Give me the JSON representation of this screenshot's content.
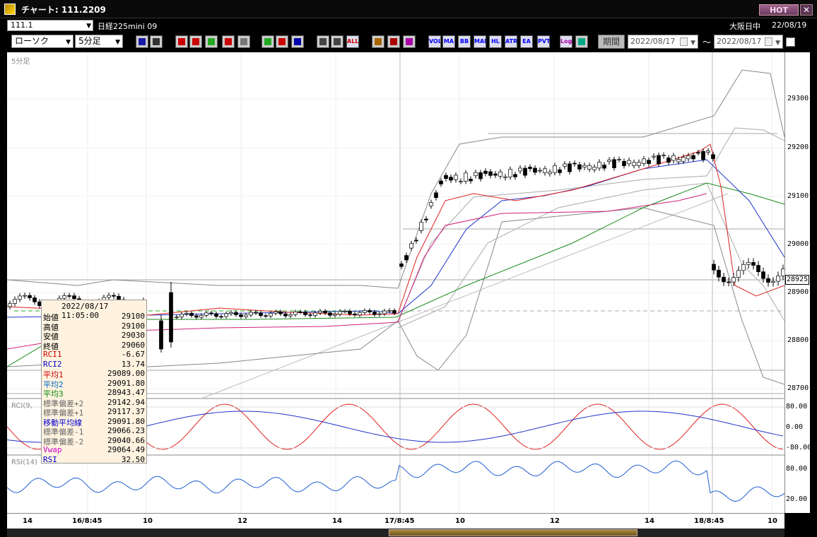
{
  "window": {
    "title": "チャート: 111.2209",
    "hot_label": "HOT",
    "close_label": "✕"
  },
  "header": {
    "symbol_code": "111.1",
    "instrument_name": "日経225mini 09",
    "market_name": "大阪日中",
    "date": "22/08/19"
  },
  "toolbar": {
    "chart_type": "ローソク",
    "interval": "5分足",
    "buttons": [
      {
        "name": "zoom-icon",
        "label": "",
        "color": "#1a1aaa"
      },
      {
        "name": "bar-icon",
        "label": "",
        "color": "#333"
      },
      {
        "name": "down-arrow-icon",
        "label": "",
        "color": "#c00"
      },
      {
        "name": "magnifier-icon",
        "label": "",
        "color": "#c00"
      },
      {
        "name": "bars-color-icon",
        "label": "",
        "color": "#2a2"
      },
      {
        "name": "plus-line-icon",
        "label": "",
        "color": "#c00"
      },
      {
        "name": "disabled-icon",
        "label": "",
        "color": "#777"
      },
      {
        "name": "pen-icon",
        "label": "",
        "color": "#2a2"
      },
      {
        "name": "cursor-icon",
        "label": "",
        "color": "#c00"
      },
      {
        "name": "undo-icon",
        "label": "",
        "color": "#00a"
      },
      {
        "name": "candle-icon",
        "label": "",
        "color": "#444"
      },
      {
        "name": "candle-delete-icon",
        "label": "",
        "color": "#444"
      },
      {
        "name": "all-icon",
        "label": "ALL",
        "color": "#c00"
      },
      {
        "name": "tool-icon",
        "label": "",
        "color": "#a60"
      },
      {
        "name": "wrench-icon",
        "label": "",
        "color": "#a00"
      },
      {
        "name": "palette-icon",
        "label": "",
        "color": "#a0a"
      },
      {
        "name": "vol-icon",
        "label": "VOL",
        "color": "#00f"
      },
      {
        "name": "ma-icon",
        "label": "MA",
        "color": "#00f"
      },
      {
        "name": "bb-icon",
        "label": "BB",
        "color": "#00f"
      },
      {
        "name": "mae-icon",
        "label": "MAE",
        "color": "#00f"
      },
      {
        "name": "hl-icon",
        "label": "HL",
        "color": "#00f"
      },
      {
        "name": "atr-icon",
        "label": "ATR",
        "color": "#00f"
      },
      {
        "name": "ea-icon",
        "label": "EA",
        "color": "#00f"
      },
      {
        "name": "pvt-icon",
        "label": "PVT",
        "color": "#00f"
      },
      {
        "name": "log-icon",
        "label": "Log",
        "color": "#a0a"
      },
      {
        "name": "export-icon",
        "label": "",
        "color": "#0a8"
      }
    ],
    "period_label": "期間",
    "date_from": "2022/08/17",
    "date_to": "2022/08/17",
    "tilde": "〜"
  },
  "chart": {
    "interval_label": "5分足",
    "price_labels": [
      "29300",
      "29200",
      "29100",
      "29000",
      "28900",
      "28800",
      "28700"
    ],
    "current_price": "28925",
    "rci_label": "RCI(9,",
    "rci_levels": [
      "80.00",
      "0.00",
      "-80.00"
    ],
    "rsi_label": "RSI(14)",
    "rsi_levels": [
      "80.00",
      "20.00"
    ],
    "time_labels": [
      "14",
      "16/8:45",
      "10",
      "12",
      "14",
      "17/8:45",
      "10",
      "12",
      "14",
      "18/8:45",
      "10"
    ]
  },
  "info_panel": {
    "datetime": "2022/08/17 11:05:00",
    "rows": [
      {
        "k": "始値",
        "v": "29100",
        "c": "#000"
      },
      {
        "k": "高値",
        "v": "29100",
        "c": "#000"
      },
      {
        "k": "安値",
        "v": "29030",
        "c": "#000"
      },
      {
        "k": "終値",
        "v": "29060",
        "c": "#000"
      },
      {
        "k": "RCI1",
        "v": "-6.67",
        "c": "#c00"
      },
      {
        "k": "RCI2",
        "v": "13.74",
        "c": "#00c"
      },
      {
        "k": "平均1",
        "v": "29089.00",
        "c": "#c00"
      },
      {
        "k": "平均2",
        "v": "29091.80",
        "c": "#06c"
      },
      {
        "k": "平均3",
        "v": "28943.47",
        "c": "#080"
      },
      {
        "k": "標準偏差+2",
        "v": "29142.94",
        "c": "#666"
      },
      {
        "k": "標準偏差+1",
        "v": "29117.37",
        "c": "#666"
      },
      {
        "k": "移動平均線",
        "v": "29091.80",
        "c": "#00c"
      },
      {
        "k": "標準偏差-1",
        "v": "29066.23",
        "c": "#666"
      },
      {
        "k": "標準偏差-2",
        "v": "29040.66",
        "c": "#666"
      },
      {
        "k": "Vwap",
        "v": "29064.49",
        "c": "#c0c"
      },
      {
        "k": "RSI",
        "v": "32.50",
        "c": "#00c"
      }
    ]
  }
}
